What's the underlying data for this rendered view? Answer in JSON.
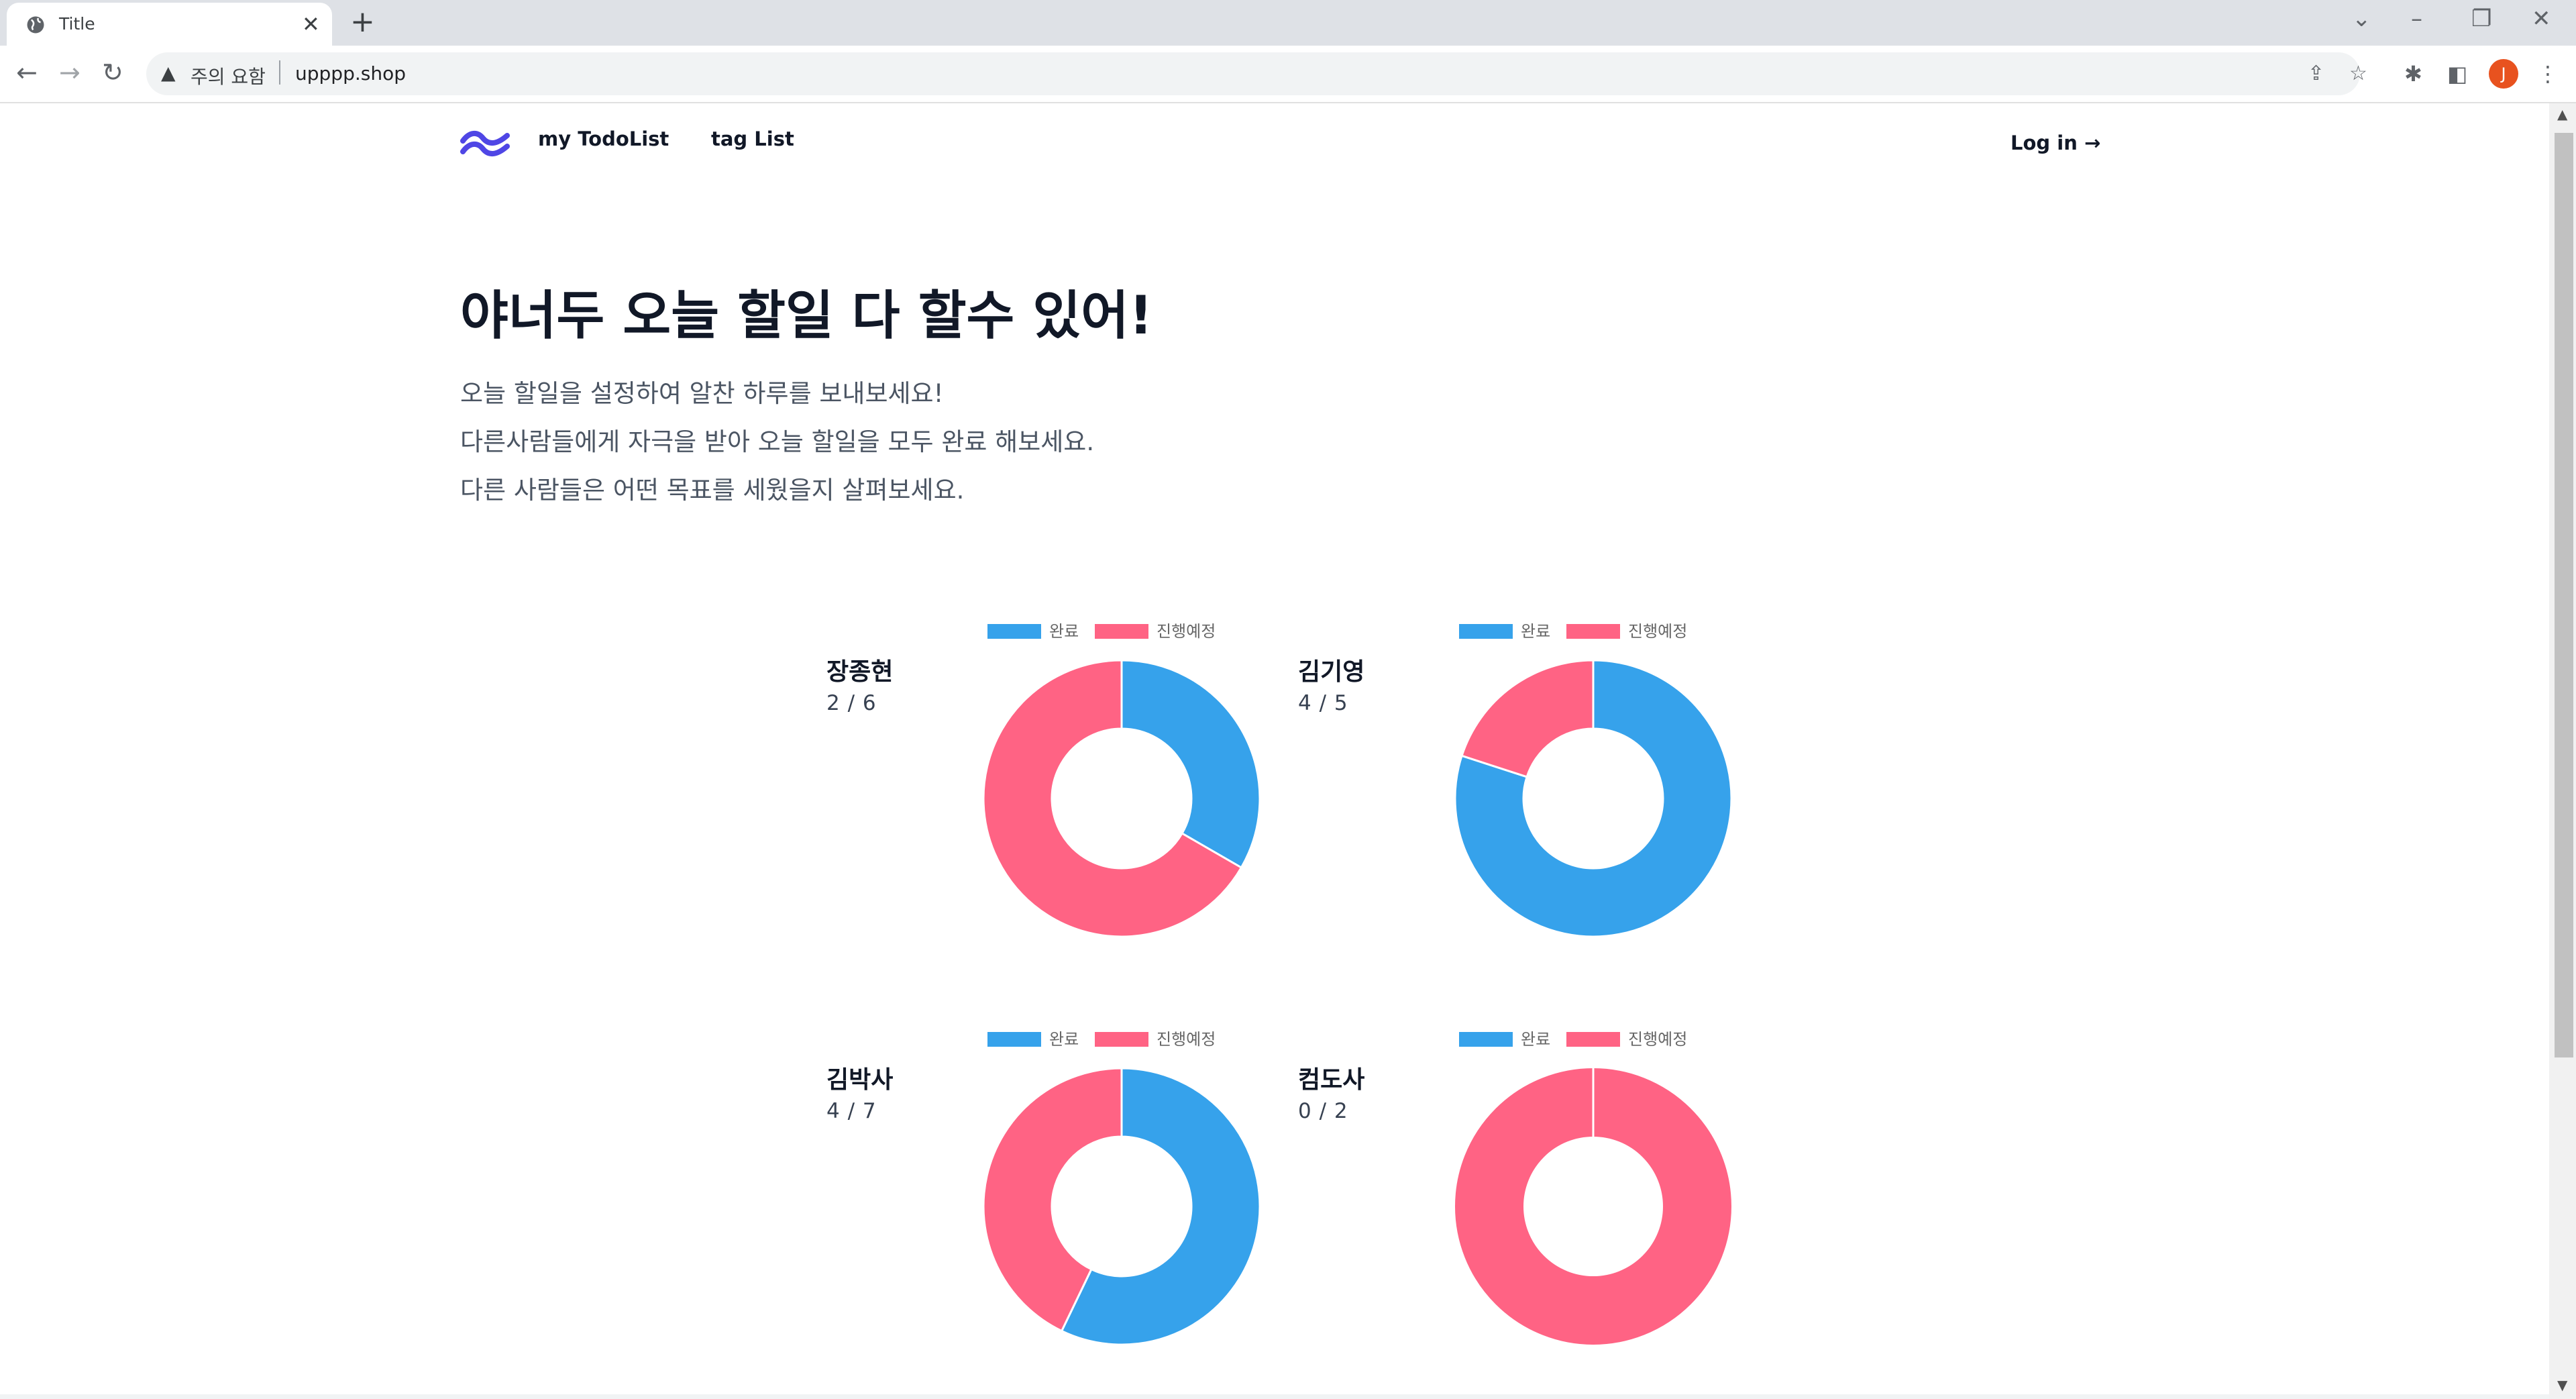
{
  "browser": {
    "tab_title": "Title",
    "security_label": "주의 요함",
    "url": "upppp.shop",
    "profile_initial": "J"
  },
  "site": {
    "nav": {
      "todolist_label": "my TodoList",
      "tag_list_label": "tag List",
      "login_label": "Log in →"
    },
    "hero": {
      "title": "야너두 오늘 할일 다 할수 있어!",
      "lines": [
        "오늘 할일을 설정하여 알찬 하루를 보내보세요!",
        "다른사람들에게 자극을 받아 오늘 할일을 모두 완료 해보세요.",
        "다른 사람들은 어떤 목표를 세웠을지 살펴보세요."
      ]
    }
  },
  "colors": {
    "done": "#36a2eb",
    "pending": "#ff6384",
    "logo": "#4f46e5"
  },
  "chart_data": [
    {
      "type": "pie",
      "user": "장종현",
      "progress_text": "2 / 6",
      "categories": [
        "완료",
        "진행예정"
      ],
      "values": [
        2,
        4
      ],
      "legend": "top"
    },
    {
      "type": "pie",
      "user": "김기영",
      "progress_text": "4 / 5",
      "categories": [
        "완료",
        "진행예정"
      ],
      "values": [
        4,
        1
      ],
      "legend": "top"
    },
    {
      "type": "pie",
      "user": "김박사",
      "progress_text": "4 / 7",
      "categories": [
        "완료",
        "진행예정"
      ],
      "values": [
        4,
        3
      ],
      "legend": "top"
    },
    {
      "type": "pie",
      "user": "컴도사",
      "progress_text": "0 / 2",
      "categories": [
        "완료",
        "진행예정"
      ],
      "values": [
        0,
        2
      ],
      "legend": "top"
    }
  ]
}
